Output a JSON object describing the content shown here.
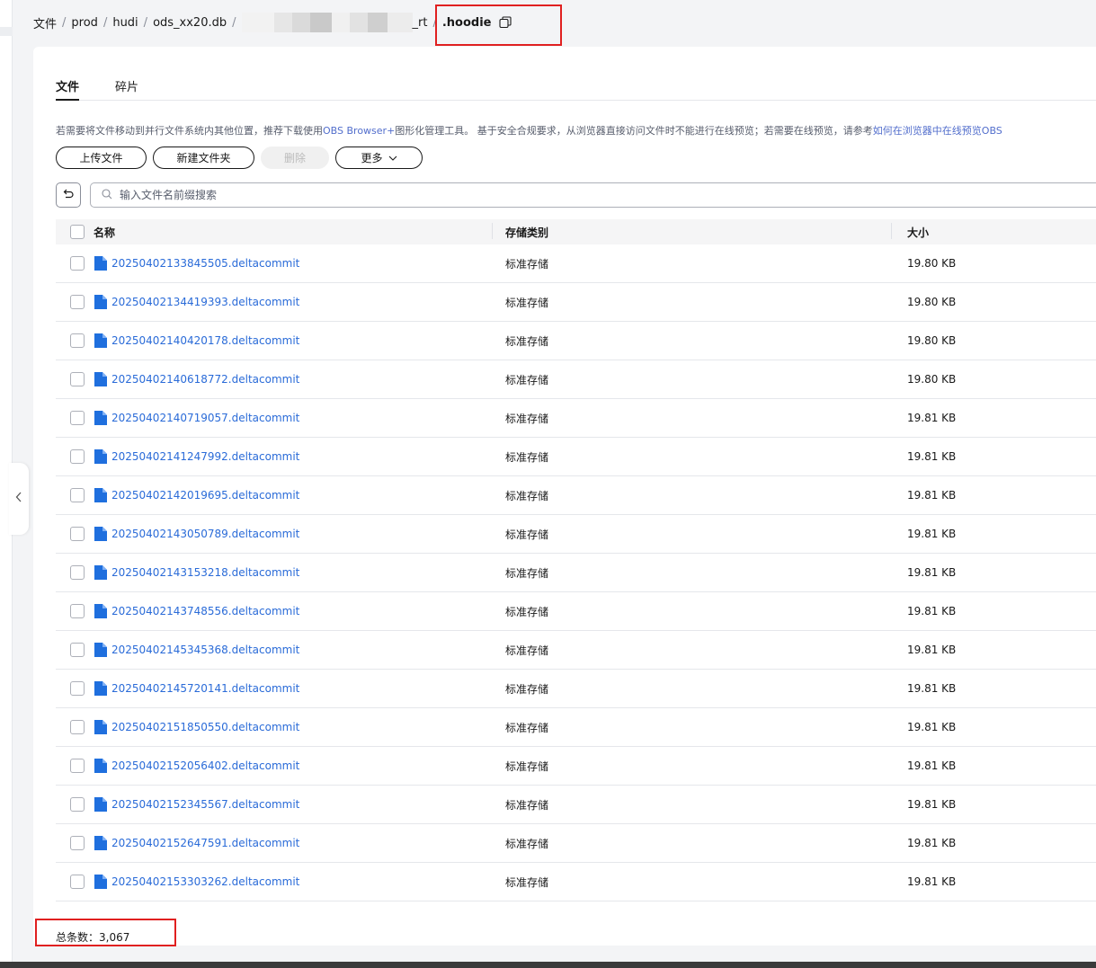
{
  "breadcrumb": {
    "items": [
      "文件",
      "prod",
      "hudi",
      "ods_xx20.db"
    ],
    "redacted_tail": "_rt",
    "current": ".hoodie"
  },
  "tabs": [
    {
      "label": "文件",
      "active": true
    },
    {
      "label": "碎片",
      "active": false
    }
  ],
  "notice": {
    "text1": "若需要将文件移动到并行文件系统内其他位置，推荐下载使用",
    "link1": "OBS Browser+",
    "text2": "图形化管理工具。 基于安全合规要求，从浏览器直接访问文件时不能进行在线预览；若需要在线预览，请参考",
    "link2": "如何在浏览器中在线预览OBS"
  },
  "actions": {
    "upload": "上传文件",
    "new_folder": "新建文件夹",
    "delete": "删除",
    "more": "更多"
  },
  "search": {
    "placeholder": "输入文件名前缀搜索"
  },
  "table": {
    "headers": {
      "name": "名称",
      "storage": "存储类别",
      "size": "大小"
    },
    "rows": [
      {
        "name": "20250402133845505.deltacommit",
        "storage": "标准存储",
        "size": "19.80 KB"
      },
      {
        "name": "20250402134419393.deltacommit",
        "storage": "标准存储",
        "size": "19.80 KB"
      },
      {
        "name": "20250402140420178.deltacommit",
        "storage": "标准存储",
        "size": "19.80 KB"
      },
      {
        "name": "20250402140618772.deltacommit",
        "storage": "标准存储",
        "size": "19.80 KB"
      },
      {
        "name": "20250402140719057.deltacommit",
        "storage": "标准存储",
        "size": "19.81 KB"
      },
      {
        "name": "20250402141247992.deltacommit",
        "storage": "标准存储",
        "size": "19.81 KB"
      },
      {
        "name": "20250402142019695.deltacommit",
        "storage": "标准存储",
        "size": "19.81 KB"
      },
      {
        "name": "20250402143050789.deltacommit",
        "storage": "标准存储",
        "size": "19.81 KB"
      },
      {
        "name": "20250402143153218.deltacommit",
        "storage": "标准存储",
        "size": "19.81 KB"
      },
      {
        "name": "20250402143748556.deltacommit",
        "storage": "标准存储",
        "size": "19.81 KB"
      },
      {
        "name": "20250402145345368.deltacommit",
        "storage": "标准存储",
        "size": "19.81 KB"
      },
      {
        "name": "20250402145720141.deltacommit",
        "storage": "标准存储",
        "size": "19.81 KB"
      },
      {
        "name": "20250402151850550.deltacommit",
        "storage": "标准存储",
        "size": "19.81 KB"
      },
      {
        "name": "20250402152056402.deltacommit",
        "storage": "标准存储",
        "size": "19.81 KB"
      },
      {
        "name": "20250402152345567.deltacommit",
        "storage": "标准存储",
        "size": "19.81 KB"
      },
      {
        "name": "20250402152647591.deltacommit",
        "storage": "标准存储",
        "size": "19.81 KB"
      },
      {
        "name": "20250402153303262.deltacommit",
        "storage": "标准存储",
        "size": "19.81 KB"
      }
    ]
  },
  "footer": {
    "total": "总条数：3,067"
  },
  "colors": {
    "link": "#2a6bd8",
    "file_icon": "#1f6fde",
    "highlight": "#e02020",
    "text": "#191919"
  },
  "icons": {
    "copy": "copy-icon",
    "refresh": "refresh-icon",
    "search": "search-icon",
    "file": "file-icon",
    "collapse": "chevron-left-icon",
    "more": "chevron-down-icon"
  }
}
